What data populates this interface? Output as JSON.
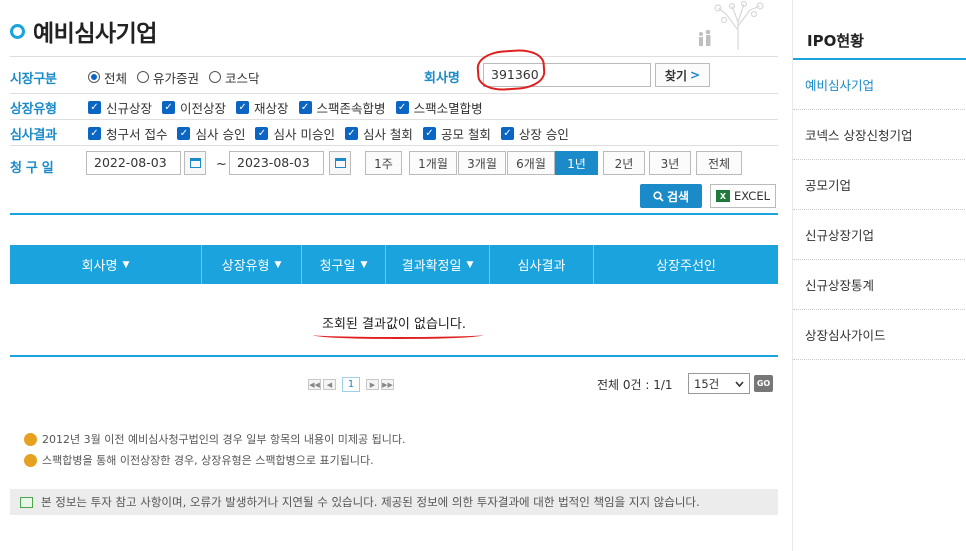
{
  "page": {
    "title": "예비심사기업"
  },
  "filters": {
    "market": {
      "label": "시장구분",
      "options": [
        {
          "label": "전체",
          "selected": true
        },
        {
          "label": "유가증권",
          "selected": false
        },
        {
          "label": "코스닥",
          "selected": false
        }
      ]
    },
    "company": {
      "label": "회사명",
      "value": "391360",
      "find_label": "찾기",
      "find_arrow": ">"
    },
    "listing_type": {
      "label": "상장유형",
      "options": [
        "신규상장",
        "이전상장",
        "재상장",
        "스팩존속합병",
        "스팩소멸합병"
      ]
    },
    "review_result": {
      "label": "심사결과",
      "options": [
        "청구서 접수",
        "심사 승인",
        "심사 미승인",
        "심사 철회",
        "공모 철회",
        "상장 승인"
      ]
    },
    "request_date": {
      "label": "청 구 일",
      "start": "2022-08-03",
      "separator": "~",
      "end": "2023-08-03",
      "periods": [
        {
          "label": "1주",
          "active": false
        },
        {
          "label": "1개월",
          "active": false
        },
        {
          "label": "3개월",
          "active": false
        },
        {
          "label": "6개월",
          "active": false
        },
        {
          "label": "1년",
          "active": true
        },
        {
          "label": "2년",
          "active": false
        },
        {
          "label": "3년",
          "active": false
        },
        {
          "label": "전체",
          "active": false
        }
      ]
    },
    "search_label": "검색",
    "excel_label": "EXCEL",
    "check_glyph": "✓"
  },
  "table": {
    "columns": [
      {
        "label": "회사명",
        "sortable": true
      },
      {
        "label": "상장유형",
        "sortable": true
      },
      {
        "label": "청구일",
        "sortable": true
      },
      {
        "label": "결과확정일",
        "sortable": true
      },
      {
        "label": "심사결과",
        "sortable": false
      },
      {
        "label": "상장주선인",
        "sortable": false
      }
    ],
    "caret": "▼",
    "empty_message": "조회된 결과값이 없습니다."
  },
  "pagination": {
    "first": "◀◀",
    "prev": "◀",
    "current_page": "1",
    "next": "▶",
    "last": "▶▶",
    "summary": "전체 0건 : 1/1",
    "page_size": "15건",
    "go_label": "GO"
  },
  "notes": [
    "2012년 3월 이전 예비심사청구법인의 경우 일부 항목의 내용이 미제공 됩니다.",
    "스팩합병을 통해 이전상장한 경우, 상장유형은 스팩합병으로 표기됩니다."
  ],
  "disclaimer": "본 정보는 투자 참고 사항이며, 오류가 발생하거나 지연될 수 있습니다. 제공된 정보에 의한 투자결과에 대한 법적인 책임을 지지 않습니다.",
  "sidebar": {
    "title": "IPO현황",
    "items": [
      {
        "label": "예비심사기업",
        "active": true
      },
      {
        "label": "코넥스 상장신청기업",
        "active": false
      },
      {
        "label": "공모기업",
        "active": false
      },
      {
        "label": "신규상장기업",
        "active": false
      },
      {
        "label": "신규상장통계",
        "active": false
      },
      {
        "label": "상장심사가이드",
        "active": false
      }
    ]
  },
  "colors": {
    "accent": "#1aa3dc",
    "link_blue": "#1a8ac9",
    "annotation_red": "#e02020"
  },
  "icons": [
    "calendar-icon",
    "search-icon",
    "excel-icon",
    "info-bubble-icon",
    "notice-icon"
  ]
}
